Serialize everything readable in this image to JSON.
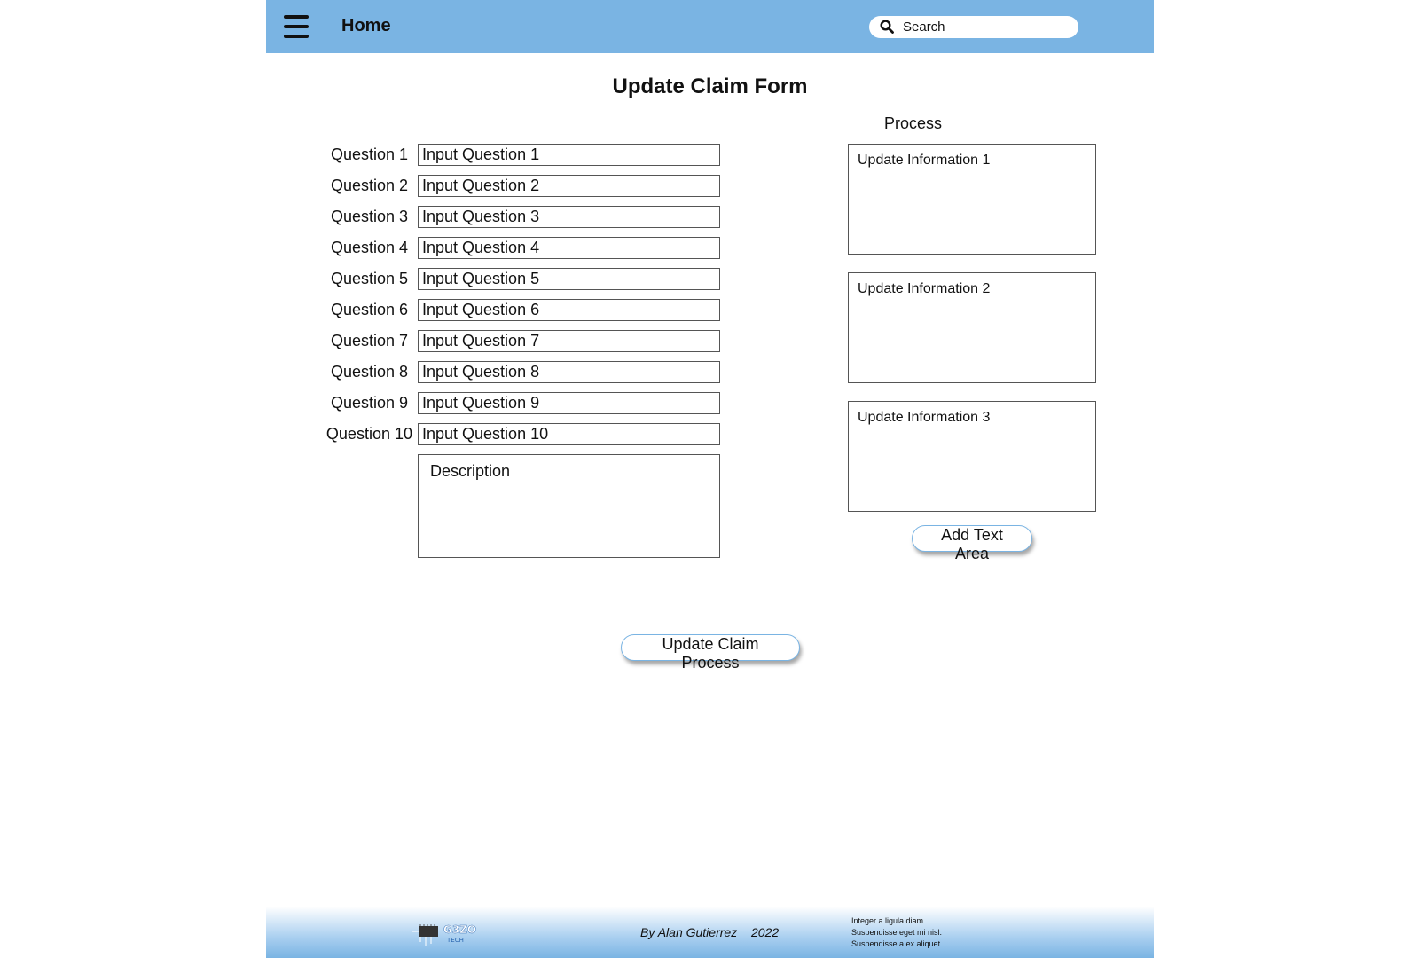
{
  "header": {
    "home_label": "Home",
    "search_placeholder": "Search",
    "background_color": "#7ab4e3"
  },
  "title": "Update Claim Form",
  "questions": [
    {
      "label": "Question 1",
      "placeholder": "Input Question 1"
    },
    {
      "label": "Question 2",
      "placeholder": "Input Question 2"
    },
    {
      "label": "Question 3",
      "placeholder": "Input Question 3"
    },
    {
      "label": "Question 4",
      "placeholder": "Input Question 4"
    },
    {
      "label": "Question 5",
      "placeholder": "Input Question 5"
    },
    {
      "label": "Question 6",
      "placeholder": "Input Question 6"
    },
    {
      "label": "Question 7",
      "placeholder": "Input Question 7"
    },
    {
      "label": "Question 8",
      "placeholder": "Input Question 8"
    },
    {
      "label": "Question 9",
      "placeholder": "Input Question 9"
    },
    {
      "label": "Question 10",
      "placeholder": "Input Question 10"
    }
  ],
  "description_placeholder": "Description",
  "process": {
    "label": "Process",
    "areas": [
      {
        "placeholder": "Update Information 1"
      },
      {
        "placeholder": "Update Information 2"
      },
      {
        "placeholder": "Update Information 3"
      }
    ],
    "add_button_label": "Add Text Area"
  },
  "submit_button_label": "Update Claim Process",
  "footer": {
    "logo_text": "G3ZO",
    "logo_subtext": "TECH",
    "credit": "By Alan Gutierrez",
    "year": "2022",
    "lines": [
      "Integer a ligula diam.",
      "Suspendisse eget mi nisl.",
      "Suspendisse a ex aliquet."
    ]
  }
}
